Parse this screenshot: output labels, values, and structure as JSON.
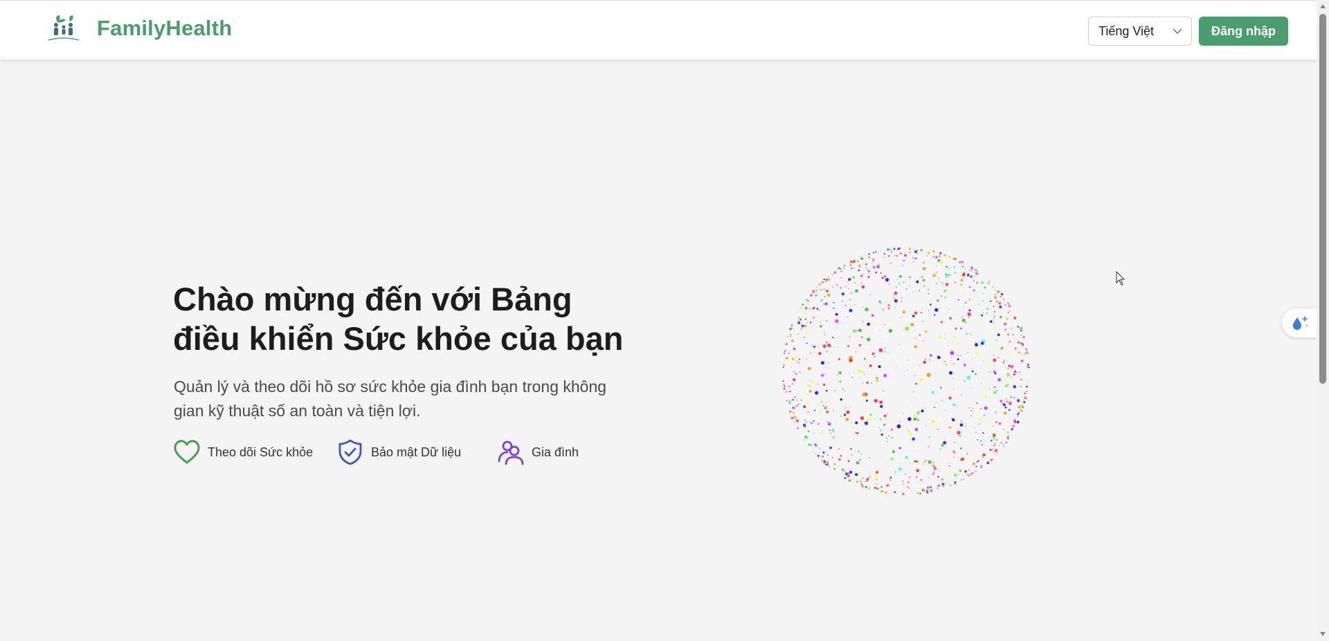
{
  "header": {
    "brand_name": "FamilyHealth",
    "language_selected": "Tiếng Việt",
    "login_label": "Đăng nhập",
    "logo_icon": "family-tree-logo-icon",
    "chevron_icon": "chevron-down-icon"
  },
  "hero": {
    "title_line1": "Chào mừng đến với Bảng",
    "title_line2": "điều khiển Sức khỏe của bạn",
    "subtitle_line1": "Quản lý và theo dõi hồ sơ sức khỏe gia đình bạn trong không",
    "subtitle_line2": "gian kỹ thuật số an toàn và tiện lợi.",
    "features": [
      {
        "label": "Theo dõi Sức khỏe",
        "icon": "heart-icon",
        "color": "#43a047"
      },
      {
        "label": "Bảo mật Dữ liệu",
        "icon": "shield-check-icon",
        "color": "#3b55c9"
      },
      {
        "label": "Gia đình",
        "icon": "users-icon",
        "color": "#7b3fd1"
      }
    ]
  },
  "widget": {
    "icon": "water-drop-sparkle-icon"
  },
  "colors": {
    "brand": "#4a9e6d",
    "background": "#f4f4f4",
    "title": "#1d1d1d",
    "subtitle": "#4a4a4a"
  }
}
